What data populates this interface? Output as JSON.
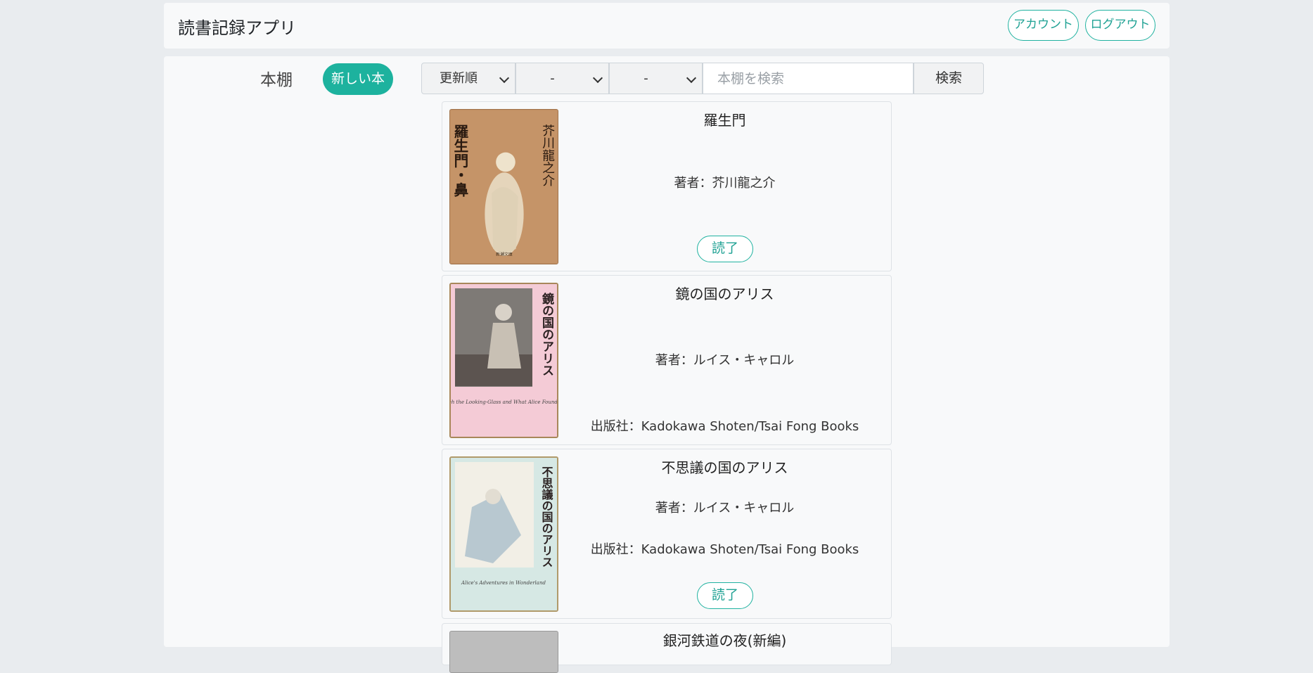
{
  "app": {
    "title": "読書記録アプリ"
  },
  "header": {
    "account_label": "アカウント",
    "logout_label": "ログアウト"
  },
  "toolbar": {
    "shelf_title": "本棚",
    "new_book_label": "新しい本",
    "sort_select": "更新順",
    "filter1_select": "-",
    "filter2_select": "-",
    "search_placeholder": "本棚を検索",
    "search_label": "検索"
  },
  "books": [
    {
      "title": "羅生門",
      "author": "著者：芥川龍之介",
      "status_label": "読了",
      "cover_text_vertical_1": "芥川龍之介",
      "cover_text_vertical_2": "羅生門・鼻",
      "cover_publisher": "新潮文庫"
    },
    {
      "title": "鏡の国のアリス",
      "author": "著者：ルイス・キャロル",
      "publisher": "出版社：Kadokawa Shoten/Tsai Fong Books",
      "cover_text_vertical_1": "鏡の国のアリス",
      "cover_subtitle_en": "Through the Looking-Glass and What Alice Found There"
    },
    {
      "title": "不思議の国のアリス",
      "author": "著者：ルイス・キャロル",
      "publisher": "出版社：Kadokawa Shoten/Tsai Fong Books",
      "status_label": "読了",
      "cover_text_vertical_1": "不思議の国のアリス",
      "cover_subtitle_en": "Alice's Adventures in Wonderland"
    },
    {
      "title": "銀河鉄道の夜(新編)"
    }
  ],
  "colors": {
    "accent": "#1db29e",
    "background": "#e9ecef",
    "panel": "#f8f9fa"
  }
}
